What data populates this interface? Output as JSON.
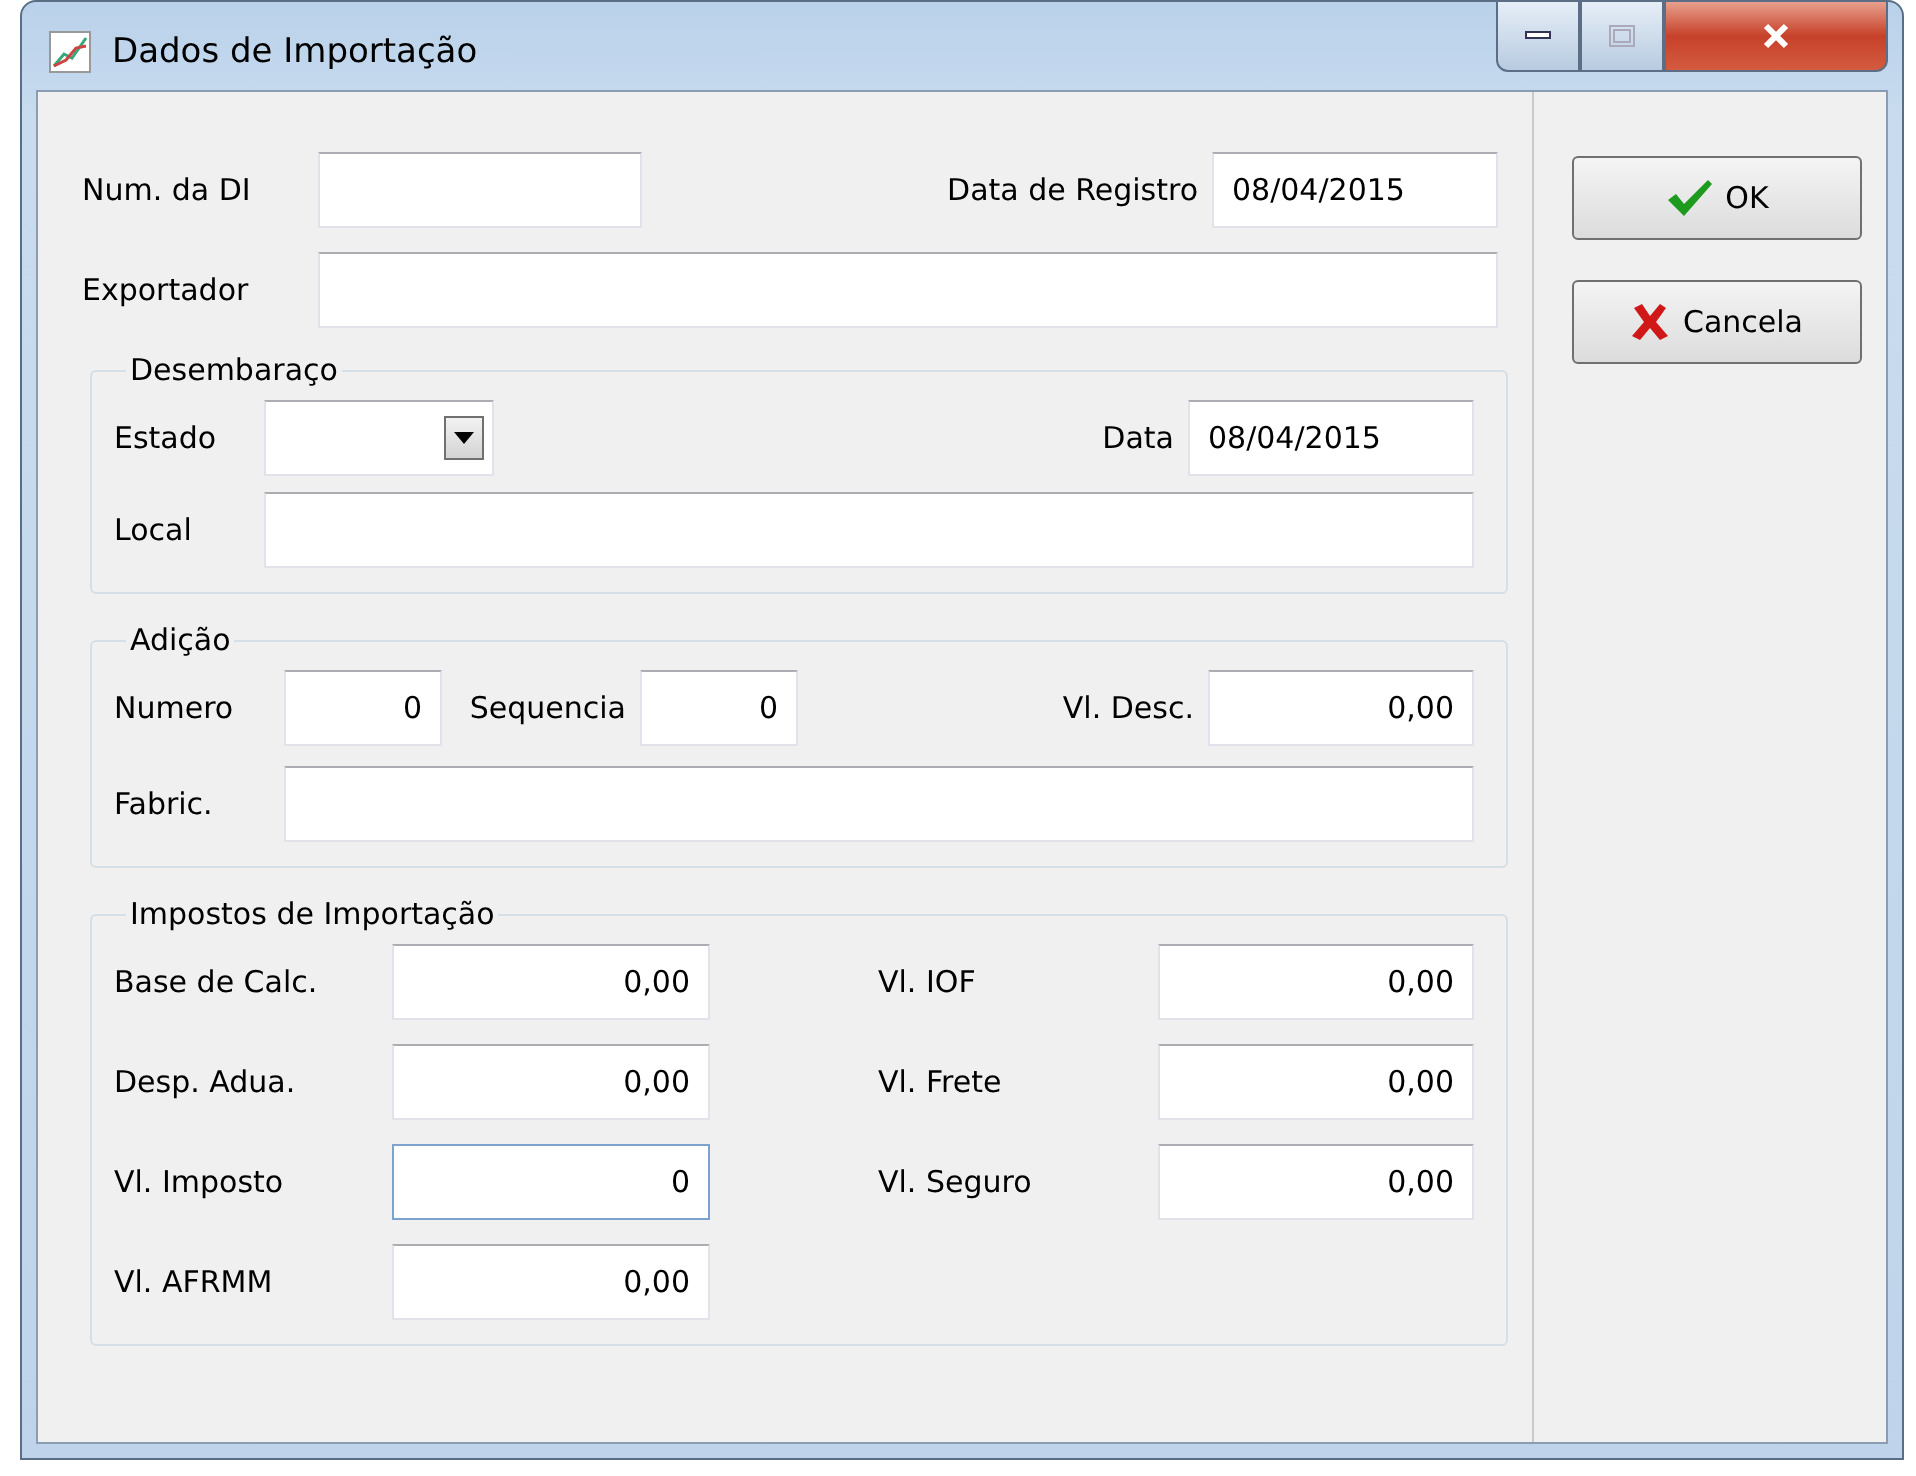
{
  "window": {
    "title": "Dados de Importação"
  },
  "main": [
    {
      "label": "Num. da DI"
    },
    {
      "label": "Data de Registro",
      "value": "08/04/2015"
    },
    {
      "label": "Exportador"
    }
  ],
  "desembaraco": {
    "title": "Desembaraço",
    "fields": [
      {
        "label": "Estado",
        "kind": "combo"
      },
      {
        "label": "Data",
        "value": "08/04/2015",
        "kind": "text"
      },
      {
        "label": "Local"
      }
    ]
  },
  "adicao": {
    "title": "Adição",
    "fields": [
      {
        "label": "Numero",
        "value": "0"
      },
      {
        "label": "Sequencia",
        "value": "0"
      },
      {
        "label": "Vl. Desc.",
        "value": "0,00"
      },
      {
        "label": "Fabric."
      }
    ]
  },
  "impostos": {
    "title": "Impostos de Importação",
    "fields": [
      {
        "label": "Base de Calc.",
        "value": "0,00",
        "focused": false
      },
      {
        "label": "Vl. IOF",
        "value": "0,00",
        "focused": false
      },
      {
        "label": "Desp. Adua.",
        "value": "0,00",
        "focused": false
      },
      {
        "label": "Vl. Frete",
        "value": "0,00",
        "focused": false
      },
      {
        "label": "Vl. Imposto",
        "value": "0",
        "focused": true
      },
      {
        "label": "Vl. Seguro",
        "value": "0,00",
        "focused": false
      },
      {
        "label": "Vl. AFRMM",
        "value": "0,00",
        "focused": false
      }
    ]
  },
  "buttons": [
    {
      "label": "OK",
      "kind": "ok"
    },
    {
      "label": "Cancela",
      "kind": "cancel"
    }
  ]
}
